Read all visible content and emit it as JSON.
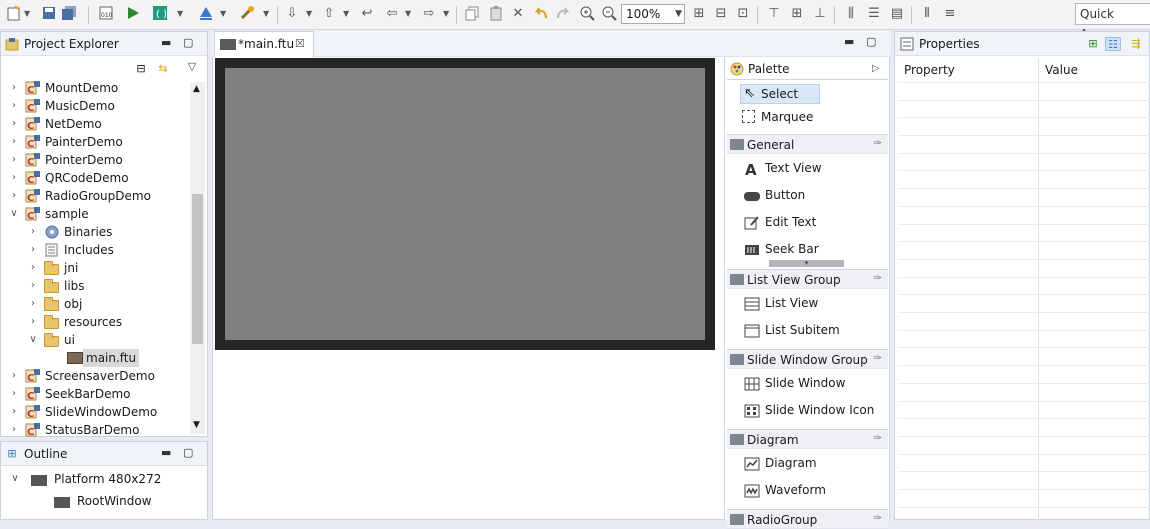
{
  "toolbar": {
    "zoom_value": "100%",
    "quick_access_placeholder": "Quick Access"
  },
  "project_explorer": {
    "title": "Project Explorer",
    "items": [
      {
        "label": "MountDemo"
      },
      {
        "label": "MusicDemo"
      },
      {
        "label": "NetDemo"
      },
      {
        "label": "PainterDemo"
      },
      {
        "label": "PointerDemo"
      },
      {
        "label": "QRCodeDemo"
      },
      {
        "label": "RadioGroupDemo"
      },
      {
        "label": "sample"
      },
      {
        "label": "Binaries"
      },
      {
        "label": "Includes"
      },
      {
        "label": "jni"
      },
      {
        "label": "libs"
      },
      {
        "label": "obj"
      },
      {
        "label": "resources"
      },
      {
        "label": "ui"
      },
      {
        "label": "main.ftu"
      },
      {
        "label": "ScreensaverDemo"
      },
      {
        "label": "SeekBarDemo"
      },
      {
        "label": "SlideWindowDemo"
      },
      {
        "label": "StatusBarDemo"
      }
    ]
  },
  "outline": {
    "title": "Outline",
    "platform": "Platform 480x272",
    "root": "RootWindow"
  },
  "editor": {
    "tab_label": "*main.ftu"
  },
  "palette": {
    "title": "Palette",
    "select": "Select",
    "marquee": "Marquee",
    "groups": [
      {
        "label": "General",
        "items": [
          "Text View",
          "Button",
          "Edit Text",
          "Seek Bar"
        ]
      },
      {
        "label": "List View Group",
        "items": [
          "List View",
          "List Subitem"
        ]
      },
      {
        "label": "Slide Window Group",
        "items": [
          "Slide Window",
          "Slide Window Icon"
        ]
      },
      {
        "label": "Diagram",
        "items": [
          "Diagram",
          "Waveform"
        ]
      },
      {
        "label": "RadioGroup",
        "items": []
      }
    ]
  },
  "properties": {
    "title": "Properties",
    "col_property": "Property",
    "col_value": "Value"
  },
  "colors": {
    "canvas": "#808080",
    "canvas_border": "#262626",
    "selection": "#d9e7f7",
    "accent": "#2a8a2a"
  }
}
